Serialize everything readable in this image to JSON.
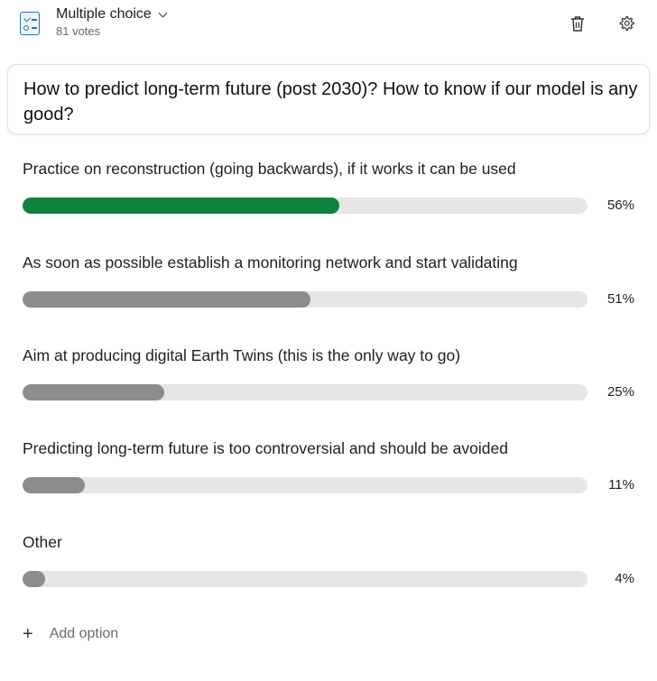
{
  "header": {
    "type_label": "Multiple choice",
    "votes": "81 votes",
    "type_icon": "checklist-icon",
    "delete_icon": "trash-icon",
    "settings_icon": "gear-icon"
  },
  "question": "How to predict long-term future (post 2030)? How to know if our model is any good?",
  "colors": {
    "leader": "#12803f",
    "bar": "#8c8c8c",
    "track": "#e6e6e6"
  },
  "options": [
    {
      "label": "Practice on reconstruction (going backwards), if it works it can be used",
      "percent": 56,
      "percent_label": "56%"
    },
    {
      "label": "As soon as possible establish a monitoring network and start validating",
      "percent": 51,
      "percent_label": "51%"
    },
    {
      "label": "Aim at producing digital Earth Twins (this is the only way to go)",
      "percent": 25,
      "percent_label": "25%"
    },
    {
      "label": "Predicting long-term future is too controversial and should be avoided",
      "percent": 11,
      "percent_label": "11%"
    },
    {
      "label": "Other",
      "percent": 4,
      "percent_label": "4%"
    }
  ],
  "add_option": {
    "icon": "plus-icon",
    "label": "Add option"
  }
}
